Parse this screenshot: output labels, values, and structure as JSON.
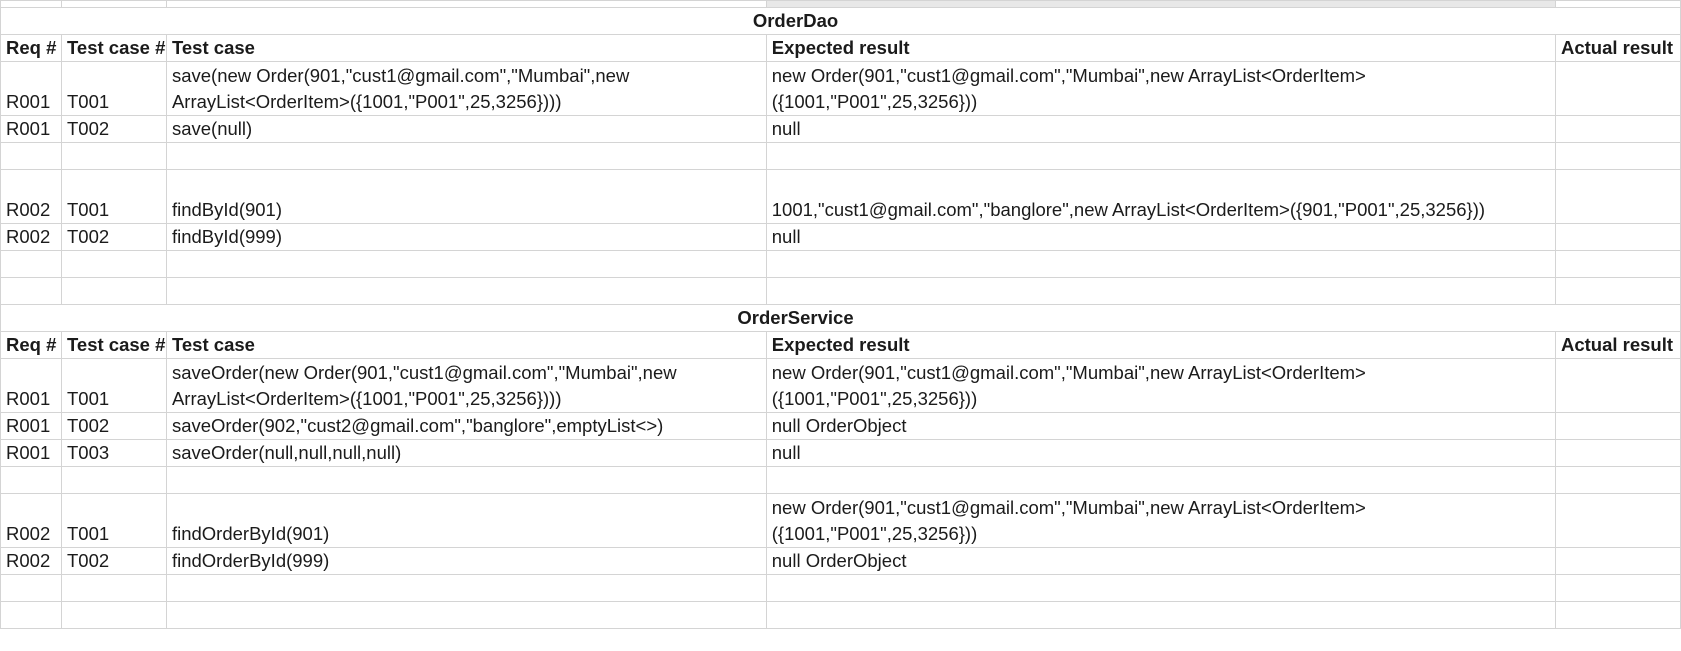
{
  "sections": [
    {
      "title": "OrderDao",
      "headers": [
        "Req #",
        "Test case #",
        "Test case",
        "Expected result",
        "Actual result"
      ],
      "rows": [
        {
          "req": "R001",
          "tc": "T001",
          "case": "save(new Order(901,\"cust1@gmail.com\",\"Mumbai\",new ArrayList<OrderItem>({1001,\"P001\",25,3256})))",
          "expected": "new Order(901,\"cust1@gmail.com\",\"Mumbai\",new ArrayList<OrderItem>({1001,\"P001\",25,3256}))",
          "actual": ""
        },
        {
          "req": "R001",
          "tc": "T002",
          "case": "save(null)",
          "expected": "null",
          "actual": ""
        },
        {
          "req": "",
          "tc": "",
          "case": "",
          "expected": "",
          "actual": ""
        },
        {
          "req": "R002",
          "tc": "T001",
          "case": "findById(901)",
          "expected": "1001,\"cust1@gmail.com\",\"banglore\",new ArrayList<OrderItem>({901,\"P001\",25,3256}))",
          "actual": ""
        },
        {
          "req": "R002",
          "tc": "T002",
          "case": "findById(999)",
          "expected": "null",
          "actual": ""
        },
        {
          "req": "",
          "tc": "",
          "case": "",
          "expected": "",
          "actual": ""
        },
        {
          "req": "",
          "tc": "",
          "case": "",
          "expected": "",
          "actual": ""
        }
      ]
    },
    {
      "title": "OrderService",
      "headers": [
        "Req #",
        "Test case #",
        "Test case",
        "Expected result",
        "Actual result"
      ],
      "rows": [
        {
          "req": "R001",
          "tc": "T001",
          "case": "saveOrder(new Order(901,\"cust1@gmail.com\",\"Mumbai\",new ArrayList<OrderItem>({1001,\"P001\",25,3256})))",
          "expected": "new Order(901,\"cust1@gmail.com\",\"Mumbai\",new ArrayList<OrderItem>({1001,\"P001\",25,3256}))",
          "actual": ""
        },
        {
          "req": "R001",
          "tc": "T002",
          "case": "saveOrder(902,\"cust2@gmail.com\",\"banglore\",emptyList<>)",
          "expected": "null OrderObject",
          "actual": ""
        },
        {
          "req": "R001",
          "tc": "T003",
          "case": "saveOrder(null,null,null,null)",
          "expected": "null",
          "actual": ""
        },
        {
          "req": "",
          "tc": "",
          "case": "",
          "expected": "",
          "actual": ""
        },
        {
          "req": "R002",
          "tc": "T001",
          "case": "findOrderById(901)",
          "expected": "new Order(901,\"cust1@gmail.com\",\"Mumbai\",new ArrayList<OrderItem>({1001,\"P001\",25,3256}))",
          "actual": ""
        },
        {
          "req": "R002",
          "tc": "T002",
          "case": "findOrderById(999)",
          "expected": "null OrderObject",
          "actual": ""
        },
        {
          "req": "",
          "tc": "",
          "case": "",
          "expected": "",
          "actual": ""
        },
        {
          "req": "",
          "tc": "",
          "case": "",
          "expected": "",
          "actual": ""
        }
      ]
    }
  ]
}
